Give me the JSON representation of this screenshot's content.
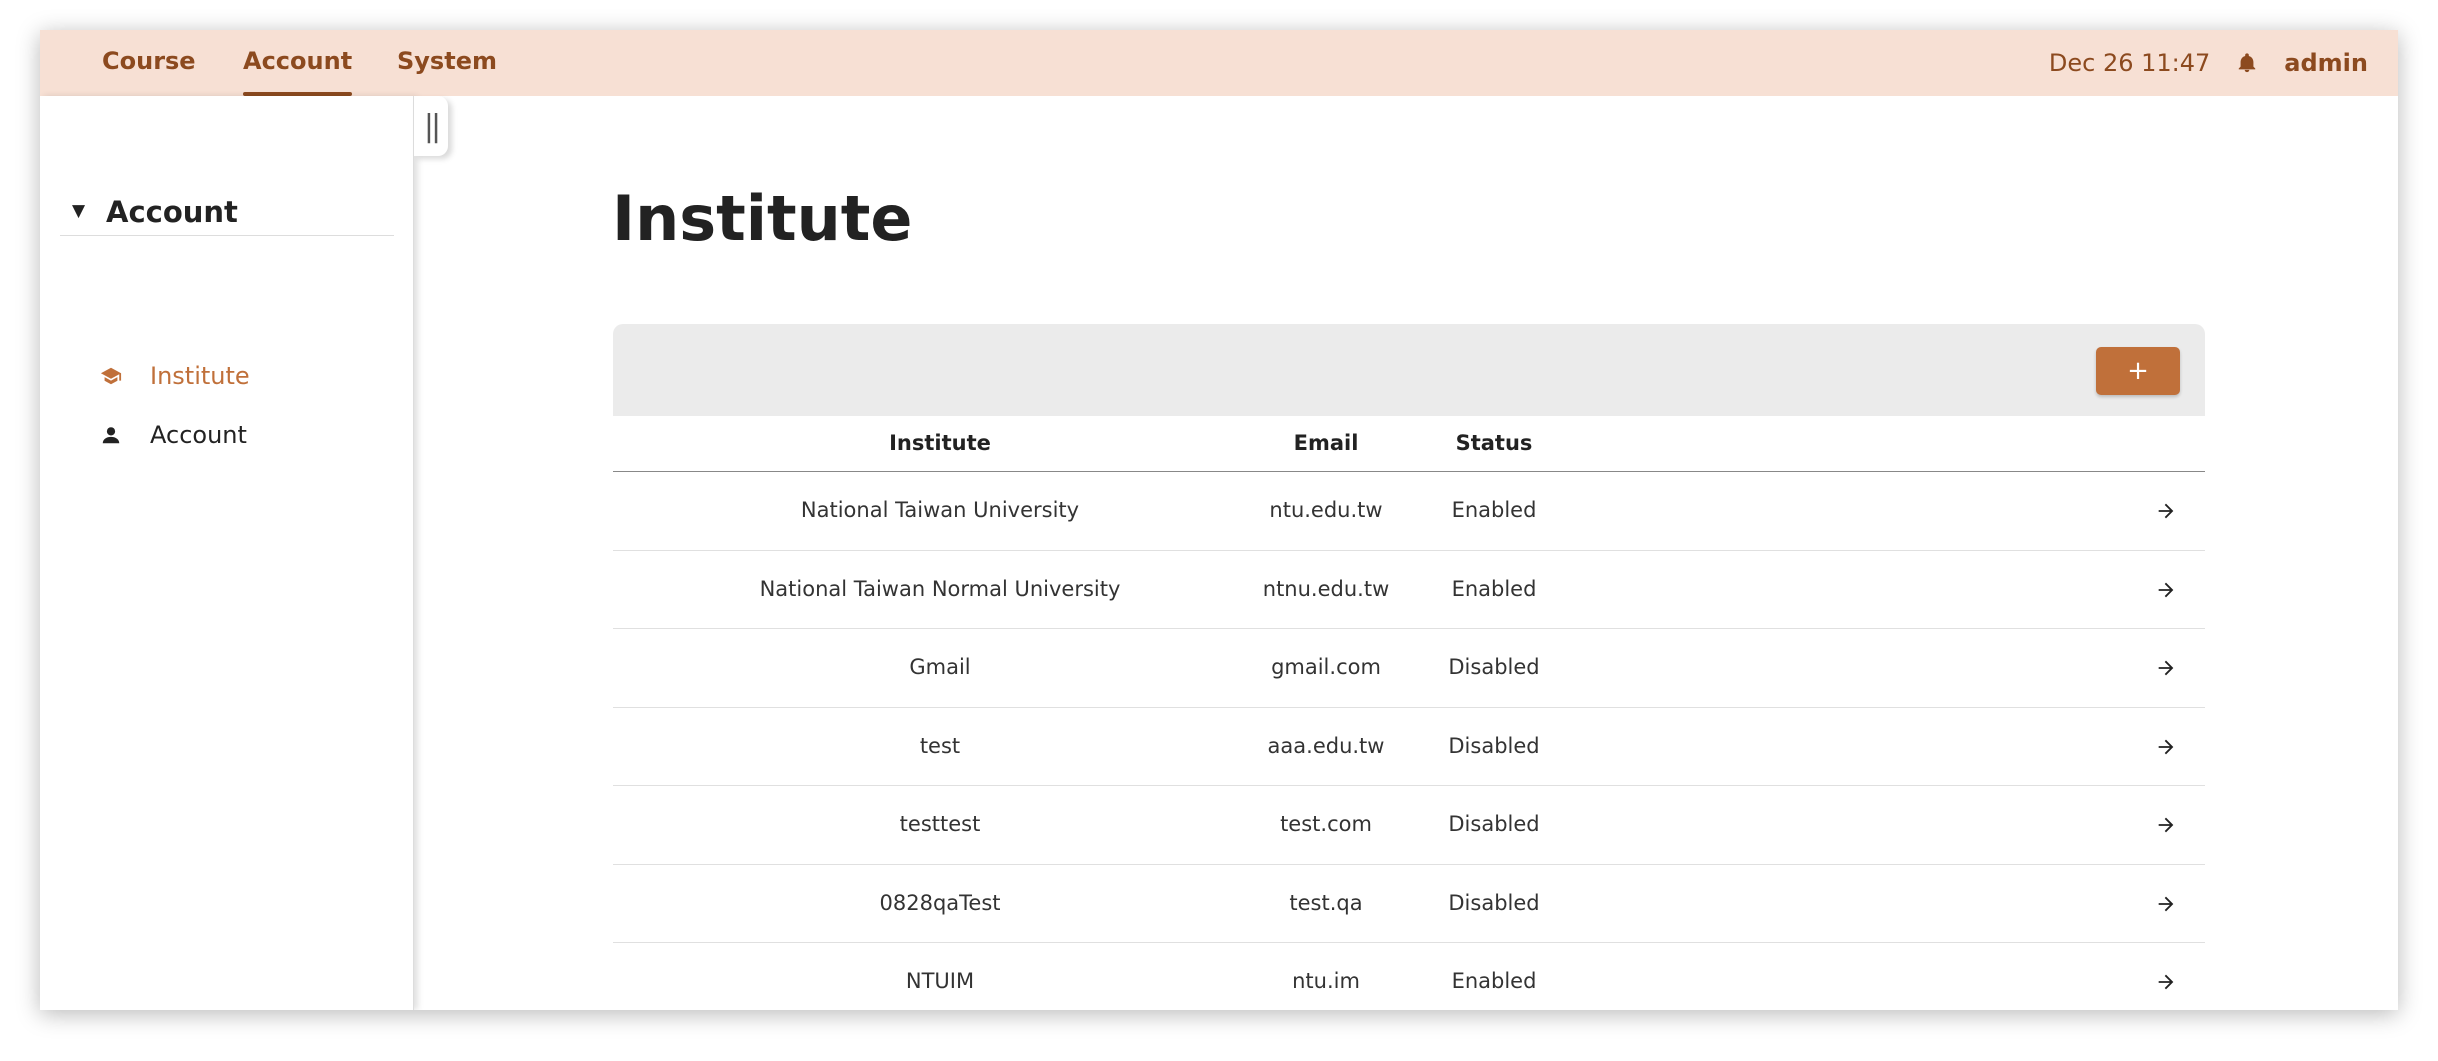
{
  "header": {
    "tabs": [
      {
        "label": "Course",
        "active": false
      },
      {
        "label": "Account",
        "active": true
      },
      {
        "label": "System",
        "active": false
      }
    ],
    "datetime": "Dec 26 11:47",
    "notification_icon": "bell-icon",
    "user": "admin"
  },
  "sidebar": {
    "collapse_icon": "collapse-handle-icon",
    "section": {
      "title": "Account",
      "icon": "caret-down-icon",
      "caret": "▼"
    },
    "items": [
      {
        "label": "Institute",
        "icon": "graduation-cap-icon",
        "active": true
      },
      {
        "label": "Account",
        "icon": "person-icon",
        "active": false
      }
    ]
  },
  "main": {
    "title": "Institute",
    "add_button_label": "+",
    "table": {
      "headers": {
        "institute": "Institute",
        "email": "Email",
        "status": "Status"
      },
      "rows": [
        {
          "institute": "National Taiwan University",
          "email": "ntu.edu.tw",
          "status": "Enabled"
        },
        {
          "institute": "National Taiwan Normal University",
          "email": "ntnu.edu.tw",
          "status": "Enabled"
        },
        {
          "institute": "Gmail",
          "email": "gmail.com",
          "status": "Disabled"
        },
        {
          "institute": "test",
          "email": "aaa.edu.tw",
          "status": "Disabled"
        },
        {
          "institute": "testtest",
          "email": "test.com",
          "status": "Disabled"
        },
        {
          "institute": "0828qaTest",
          "email": "test.qa",
          "status": "Disabled"
        },
        {
          "institute": "NTUIM",
          "email": "ntu.im",
          "status": "Enabled"
        }
      ],
      "row_action_icon": "arrow-right-icon"
    }
  },
  "colors": {
    "topbar_bg": "#f7e0d4",
    "nav_text": "#8c4a1f",
    "accent": "#c0703a",
    "toolbar_bg": "#ebebeb"
  }
}
